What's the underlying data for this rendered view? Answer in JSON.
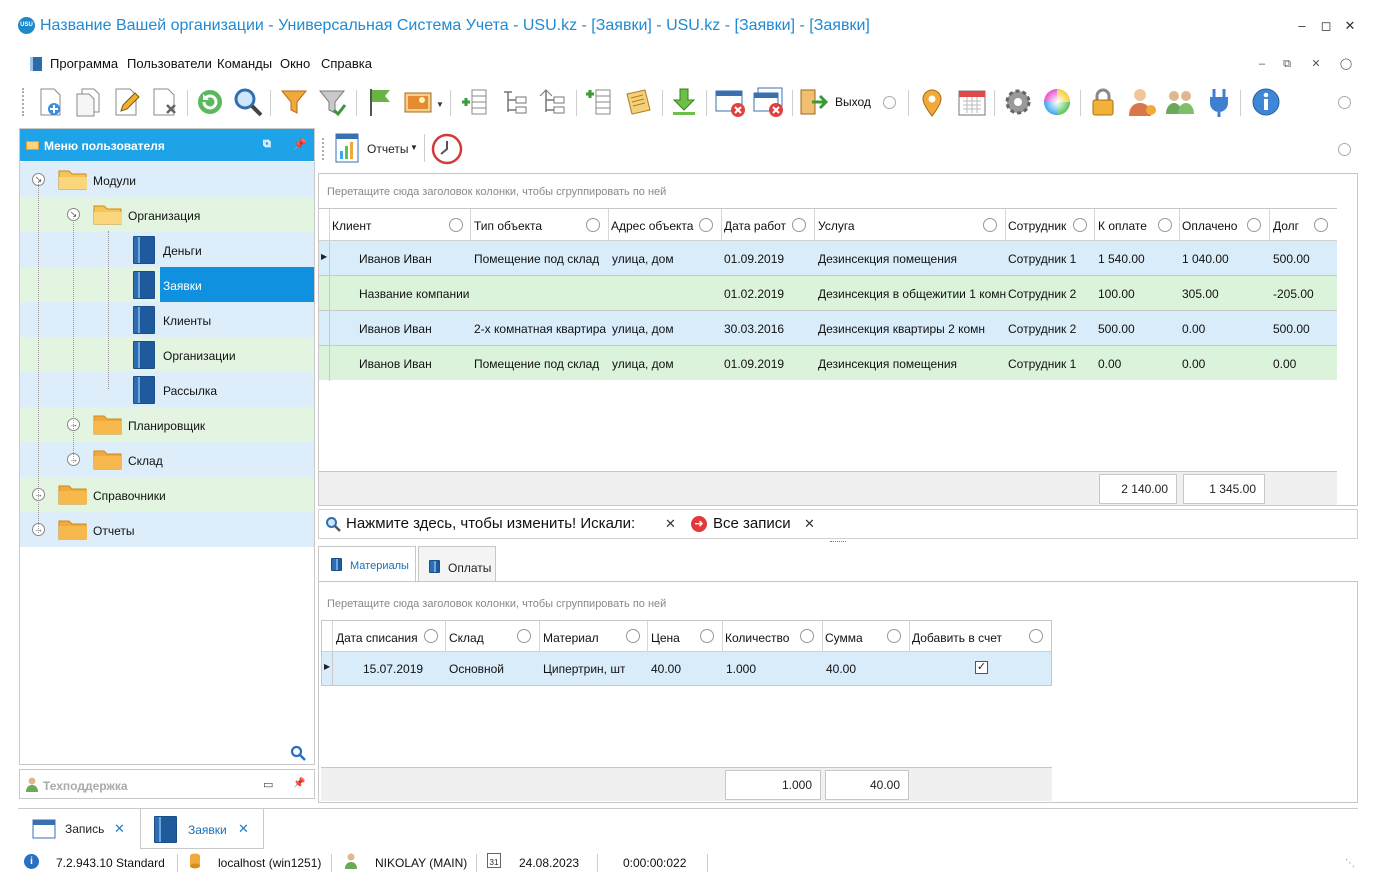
{
  "window": {
    "title": "Название Вашей организации - Универсальная Система Учета - USU.kz - [Заявки] - USU.kz - [Заявки] - [Заявки]",
    "logo_text": "USU"
  },
  "menu": {
    "items": [
      "Программа",
      "Пользователи",
      "Команды",
      "Окно",
      "Справка"
    ]
  },
  "toolbar": {
    "exit_label": "Выход"
  },
  "left_panel": {
    "header": "Меню пользователя",
    "tree": [
      {
        "label": "Модули",
        "type": "folder",
        "level": 0,
        "expanded": true
      },
      {
        "label": "Организация",
        "type": "folder",
        "level": 1,
        "expanded": true
      },
      {
        "label": "Деньги",
        "type": "book",
        "level": 2
      },
      {
        "label": "Заявки",
        "type": "book",
        "level": 2,
        "selected": true
      },
      {
        "label": "Клиенты",
        "type": "book",
        "level": 2
      },
      {
        "label": "Организации",
        "type": "book",
        "level": 2
      },
      {
        "label": "Рассылка",
        "type": "book",
        "level": 2
      },
      {
        "label": "Планировщик",
        "type": "folder",
        "level": 1,
        "expanded": false
      },
      {
        "label": "Склад",
        "type": "folder",
        "level": 1,
        "expanded": false
      },
      {
        "label": "Справочники",
        "type": "folder",
        "level": 0,
        "expanded": false
      },
      {
        "label": "Отчеты",
        "type": "folder",
        "level": 0,
        "expanded": false
      }
    ],
    "support_label": "Техподдержка"
  },
  "right_toolbar": {
    "reports_label": "Отчеты"
  },
  "main_grid": {
    "group_hint": "Перетащите сюда заголовок колонки, чтобы сгруппировать по ней",
    "columns": [
      "Клиент",
      "Тип объекта",
      "Адрес объекта",
      "Дата работ",
      "Услуга",
      "Сотрудник",
      "К оплате",
      "Оплачено",
      "Долг"
    ],
    "rows": [
      [
        "Иванов Иван",
        "Помещение под склад",
        "улица, дом",
        "01.09.2019",
        "Дезинсекция помещения",
        "Сотрудник 1",
        "1 540.00",
        "1 040.00",
        "500.00"
      ],
      [
        "Название компании",
        "",
        "",
        "01.02.2019",
        "Дезинсекция в общежитии 1 комн",
        "Сотрудник 2",
        "100.00",
        "305.00",
        "-205.00"
      ],
      [
        "Иванов Иван",
        "2-х комнатная квартира",
        "улица, дом",
        "30.03.2016",
        "Дезинсекция квартиры 2 комн",
        "Сотрудник 2",
        "500.00",
        "0.00",
        "500.00"
      ],
      [
        "Иванов Иван",
        "Помещение под склад",
        "улица, дом",
        "01.09.2019",
        "Дезинсекция помещения",
        "Сотрудник 1",
        "0.00",
        "0.00",
        "0.00"
      ]
    ],
    "totals": {
      "to_pay": "2 140.00",
      "paid": "1 345.00"
    }
  },
  "filter_bar": {
    "text": "Нажмите здесь, чтобы изменить! Искали:",
    "filter_value": "Все записи"
  },
  "sub_tabs": [
    "Материалы",
    "Оплаты"
  ],
  "sub_grid": {
    "group_hint": "Перетащите сюда заголовок колонки, чтобы сгруппировать по ней",
    "columns": [
      "Дата списания",
      "Склад",
      "Материал",
      "Цена",
      "Количество",
      "Сумма",
      "Добавить в счет"
    ],
    "rows": [
      [
        "15.07.2019",
        "Основной",
        "Ципертрин, шт",
        "40.00",
        "1.000",
        "40.00",
        true
      ]
    ],
    "totals": {
      "quantity": "1.000",
      "sum": "40.00"
    }
  },
  "doc_tabs": [
    {
      "label": "Запись"
    },
    {
      "label": "Заявки",
      "active": true
    }
  ],
  "status": {
    "version": "7.2.943.10 Standard",
    "server": "localhost (win1251)",
    "user": "NIKOLAY (MAIN)",
    "date": "24.08.2023",
    "timer": "0:00:00:022",
    "calendar_day": "31"
  },
  "colors": {
    "accent": "#1ea3e8",
    "row_blue": "#d9ecfa",
    "row_green": "#dcf3db",
    "selected": "#0f91e0"
  }
}
